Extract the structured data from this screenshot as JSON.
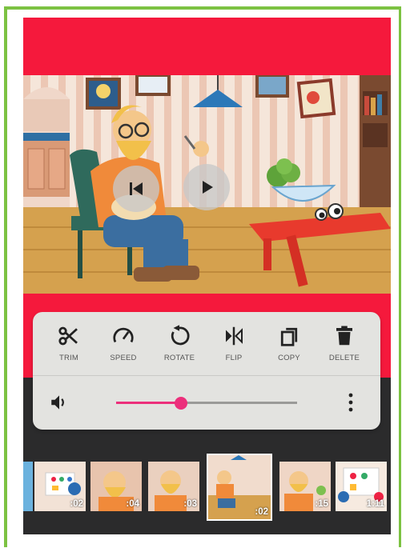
{
  "toolbar": {
    "items": [
      {
        "label": "TRIM",
        "icon": "scissors-icon"
      },
      {
        "label": "SPEED",
        "icon": "speedometer-icon"
      },
      {
        "label": "ROTATE",
        "icon": "rotate-icon"
      },
      {
        "label": "FLIP",
        "icon": "flip-icon"
      },
      {
        "label": "COPY",
        "icon": "copy-icon"
      },
      {
        "label": "DELETE",
        "icon": "trash-icon"
      }
    ]
  },
  "volume": {
    "level": 0.36,
    "icon": "speaker-icon",
    "more_icon": "more-vertical-icon"
  },
  "player": {
    "prev_icon": "skip-previous-icon",
    "play_icon": "play-icon"
  },
  "timeline": {
    "clips": [
      {
        "duration": ""
      },
      {
        "duration": ":02"
      },
      {
        "duration": ":04"
      },
      {
        "duration": ":03"
      },
      {
        "duration": ":02",
        "selected": true
      },
      {
        "duration": ":15"
      },
      {
        "duration": "1:11"
      }
    ]
  },
  "colors": {
    "accent": "#ec2f7b",
    "red": "#f5193c",
    "frame": "#7cc242",
    "dark": "#2b2b2c"
  }
}
